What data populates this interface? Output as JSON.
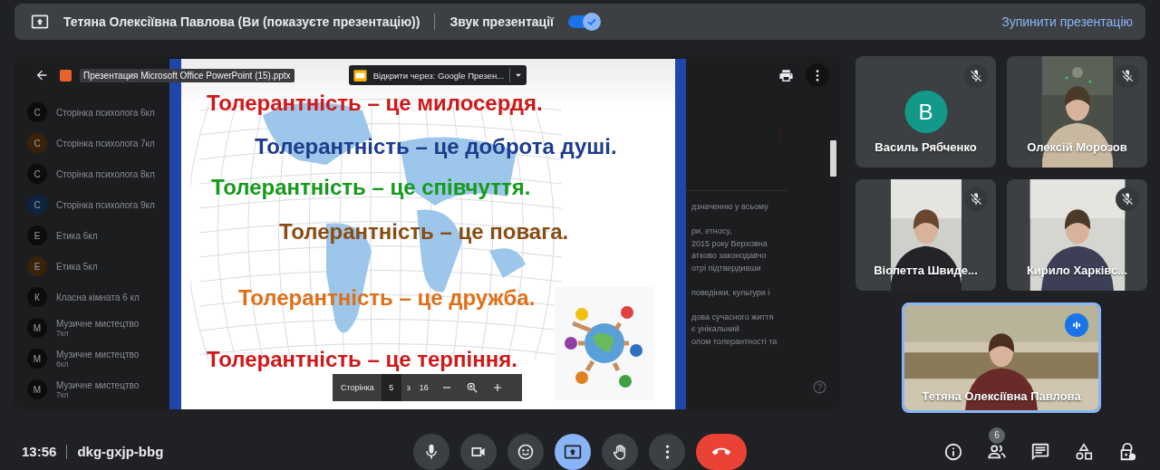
{
  "top_bar": {
    "presenter": "Тетяна Олексіївна Павлова (Ви (показуєте презентацію))",
    "audio_label": "Звук презентації",
    "audio_on": true,
    "stop_button": "Зупинити презентацію"
  },
  "viewer": {
    "filename": "Презентация Microsoft Office PowerPoint (15).pptx",
    "open_with": "Відкрити через: Google Презен...",
    "files": [
      {
        "letter": "С",
        "name": "Сторінка психолога 6кл",
        "color": "#0c0c0d"
      },
      {
        "letter": "С",
        "name": "Сторінка психолога 7кл",
        "color": "#3a2208"
      },
      {
        "letter": "С",
        "name": "Сторінка психолога 8кл",
        "color": "#0c0c0d"
      },
      {
        "letter": "С",
        "name": "Сторінка психолога 9кл",
        "color": "#0d2440"
      },
      {
        "letter": "Е",
        "name": "Етика 6кл",
        "color": "#0c0c0d"
      },
      {
        "letter": "Е",
        "name": "Етика 5кл",
        "color": "#3a2208"
      },
      {
        "letter": "К",
        "name": "Класна кімната 6 кл",
        "color": "#0c0c0d"
      },
      {
        "letter": "М",
        "name": "Музичне мистецтво",
        "subtitle": "7кл",
        "color": "#0c0c0d"
      },
      {
        "letter": "М",
        "name": "Музичне мистецтво",
        "subtitle": "6кл",
        "color": "#0c0c0d"
      },
      {
        "letter": "М",
        "name": "Музичне мистецтво",
        "subtitle": "7кл",
        "color": "#0c0c0d"
      }
    ],
    "doc_paragraphs": [
      [
        "дзначенню у всьому"
      ],
      [
        "ри, етносу,",
        "2015 року Верховна",
        "атково законодавчо",
        "отрі підтвердивши"
      ],
      [
        "поведінки, культури і"
      ],
      [
        "дова сучасного життя",
        "є унікальний",
        "олом толерантності та"
      ]
    ],
    "slide": {
      "lines": [
        {
          "text": "Толерантність – це милосердя.",
          "color": "#d01818"
        },
        {
          "text": "Толерантність – це доброта душі.",
          "color": "#1c3c8c"
        },
        {
          "text": "Толерантність – це співчуття.",
          "color": "#169a1c"
        },
        {
          "text": "Толерантність – це повага.",
          "color": "#8a4c12"
        },
        {
          "text": "Толерантність – це дружба.",
          "color": "#e07018"
        },
        {
          "text": "Толерантність – це терпіння.",
          "color": "#d01818"
        }
      ]
    },
    "pager": {
      "label": "Сторінка",
      "page": "5",
      "of": "з",
      "total": "16"
    }
  },
  "participants": [
    {
      "name": "Василь Рябченко",
      "kind": "avatar",
      "letter": "В",
      "muted": true
    },
    {
      "name": "Олексій Морозов",
      "kind": "video",
      "muted": true
    },
    {
      "name": "Віолетта Швиде...",
      "kind": "video",
      "muted": true
    },
    {
      "name": "Кирило Харківс...",
      "kind": "video",
      "muted": true
    }
  ],
  "self": {
    "name": "Тетяна Олексіївна Павлова",
    "speaking": true
  },
  "bottom_bar": {
    "time": "13:56",
    "meeting_code": "dkg-gxjp-bbg",
    "present_active": true,
    "people_count": "6"
  }
}
